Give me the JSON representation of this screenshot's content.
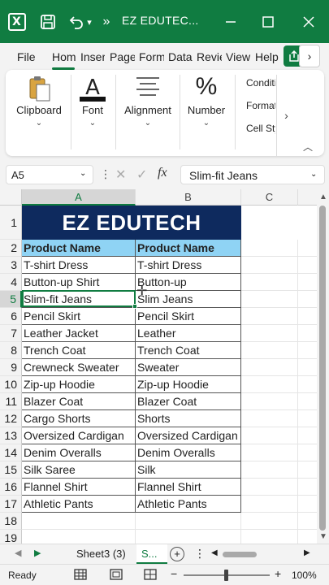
{
  "window": {
    "title": "EZ EDUTEC...",
    "more_glyph": "»"
  },
  "tabs": [
    "File",
    "Home",
    "Insert",
    "Page Layout",
    "Formulas",
    "Data",
    "Review",
    "View",
    "Help"
  ],
  "ribbon": {
    "clipboard": "Clipboard",
    "font": "Font",
    "alignment": "Alignment",
    "number": "Number",
    "conditional_formatting": "Conditional Formatting",
    "format_as_table": "Format as Table",
    "cell_styles": "Cell Styles"
  },
  "formula_bar": {
    "name_box": "A5",
    "content": "Slim-fit Jeans"
  },
  "grid": {
    "columns": [
      "A",
      "B",
      "C"
    ],
    "rows": [
      "1",
      "2",
      "3",
      "4",
      "5",
      "6",
      "7",
      "8",
      "9",
      "10",
      "11",
      "12",
      "13",
      "14",
      "15",
      "16",
      "17",
      "18",
      "19"
    ],
    "banner": "EZ EDUTECH",
    "header": [
      "Product Name",
      "Product Name"
    ],
    "data": [
      [
        "T-shirt Dress",
        "T-shirt Dress"
      ],
      [
        "Button-up Shirt",
        "Button-up"
      ],
      [
        "Slim-fit Jeans",
        "Slim Jeans"
      ],
      [
        "Pencil Skirt",
        "Pencil Skirt"
      ],
      [
        "Leather Jacket",
        "Leather"
      ],
      [
        "Trench Coat",
        "Trench Coat"
      ],
      [
        "Crewneck Sweater",
        "Sweater"
      ],
      [
        "Zip-up Hoodie",
        "Zip-up Hoodie"
      ],
      [
        "Blazer Coat",
        "Blazer Coat"
      ],
      [
        "Cargo Shorts",
        "Shorts"
      ],
      [
        "Oversized Cardigan",
        "Oversized Cardigan"
      ],
      [
        "Denim Overalls",
        "Denim Overalls"
      ],
      [
        "Silk Saree",
        "Silk"
      ],
      [
        "Flannel Shirt",
        "Flannel Shirt"
      ],
      [
        "Athletic Pants",
        "Athletic Pants"
      ]
    ],
    "selected_cell": "A5"
  },
  "sheet_tabs": {
    "inactive": "Sheet3 (3)",
    "active": "S...",
    "add": "+",
    "menu": "⋮"
  },
  "status": {
    "ready": "Ready",
    "zoom": "100%",
    "minus": "−",
    "plus": "+"
  },
  "colors": {
    "accent": "#107c41",
    "banner_bg": "#0e2a5e",
    "header_fill": "#8fd3f4"
  }
}
